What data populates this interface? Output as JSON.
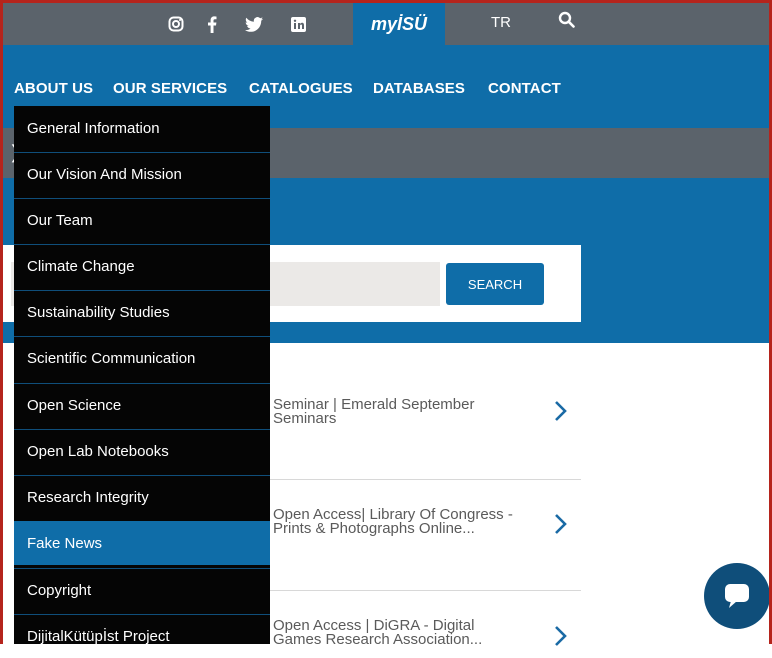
{
  "topbar": {
    "social_icons": [
      "instagram-icon",
      "facebook-icon",
      "twitter-icon",
      "linkedin-icon"
    ],
    "portal_label": "myİSÜ",
    "language": "TR",
    "search_icon": "search-icon"
  },
  "nav": {
    "items": [
      "ABOUT US",
      "OUR SERVICES",
      "CATALOGUES",
      "DATABASES",
      "CONTACT"
    ]
  },
  "search": {
    "placeholder": "",
    "button_label": "SEARCH"
  },
  "dropdown": {
    "items": [
      "General Information",
      "Our Vision And Mission",
      "Our Team",
      "Climate Change",
      "Sustainability Studies",
      "Scientific Communication",
      "Open Science",
      "Open Lab Notebooks",
      "Research Integrity",
      "Fake News",
      "Copyright",
      "DijitalKütüpİst Project"
    ],
    "active_index": 9
  },
  "news": [
    {
      "line1": "Seminar | Emerald September",
      "line2": "Seminars"
    },
    {
      "line1": "Open Access| Library Of Congress -",
      "line2": "Prints & Photographs Online..."
    },
    {
      "line1": "Open Access | DiGRA - Digital",
      "line2": "Games Research Association..."
    }
  ],
  "colors": {
    "primary_blue": "#0f6da8",
    "gray_bar": "#5b636b",
    "dropdown_bg": "#050505",
    "frame_red": "#b5241c"
  }
}
